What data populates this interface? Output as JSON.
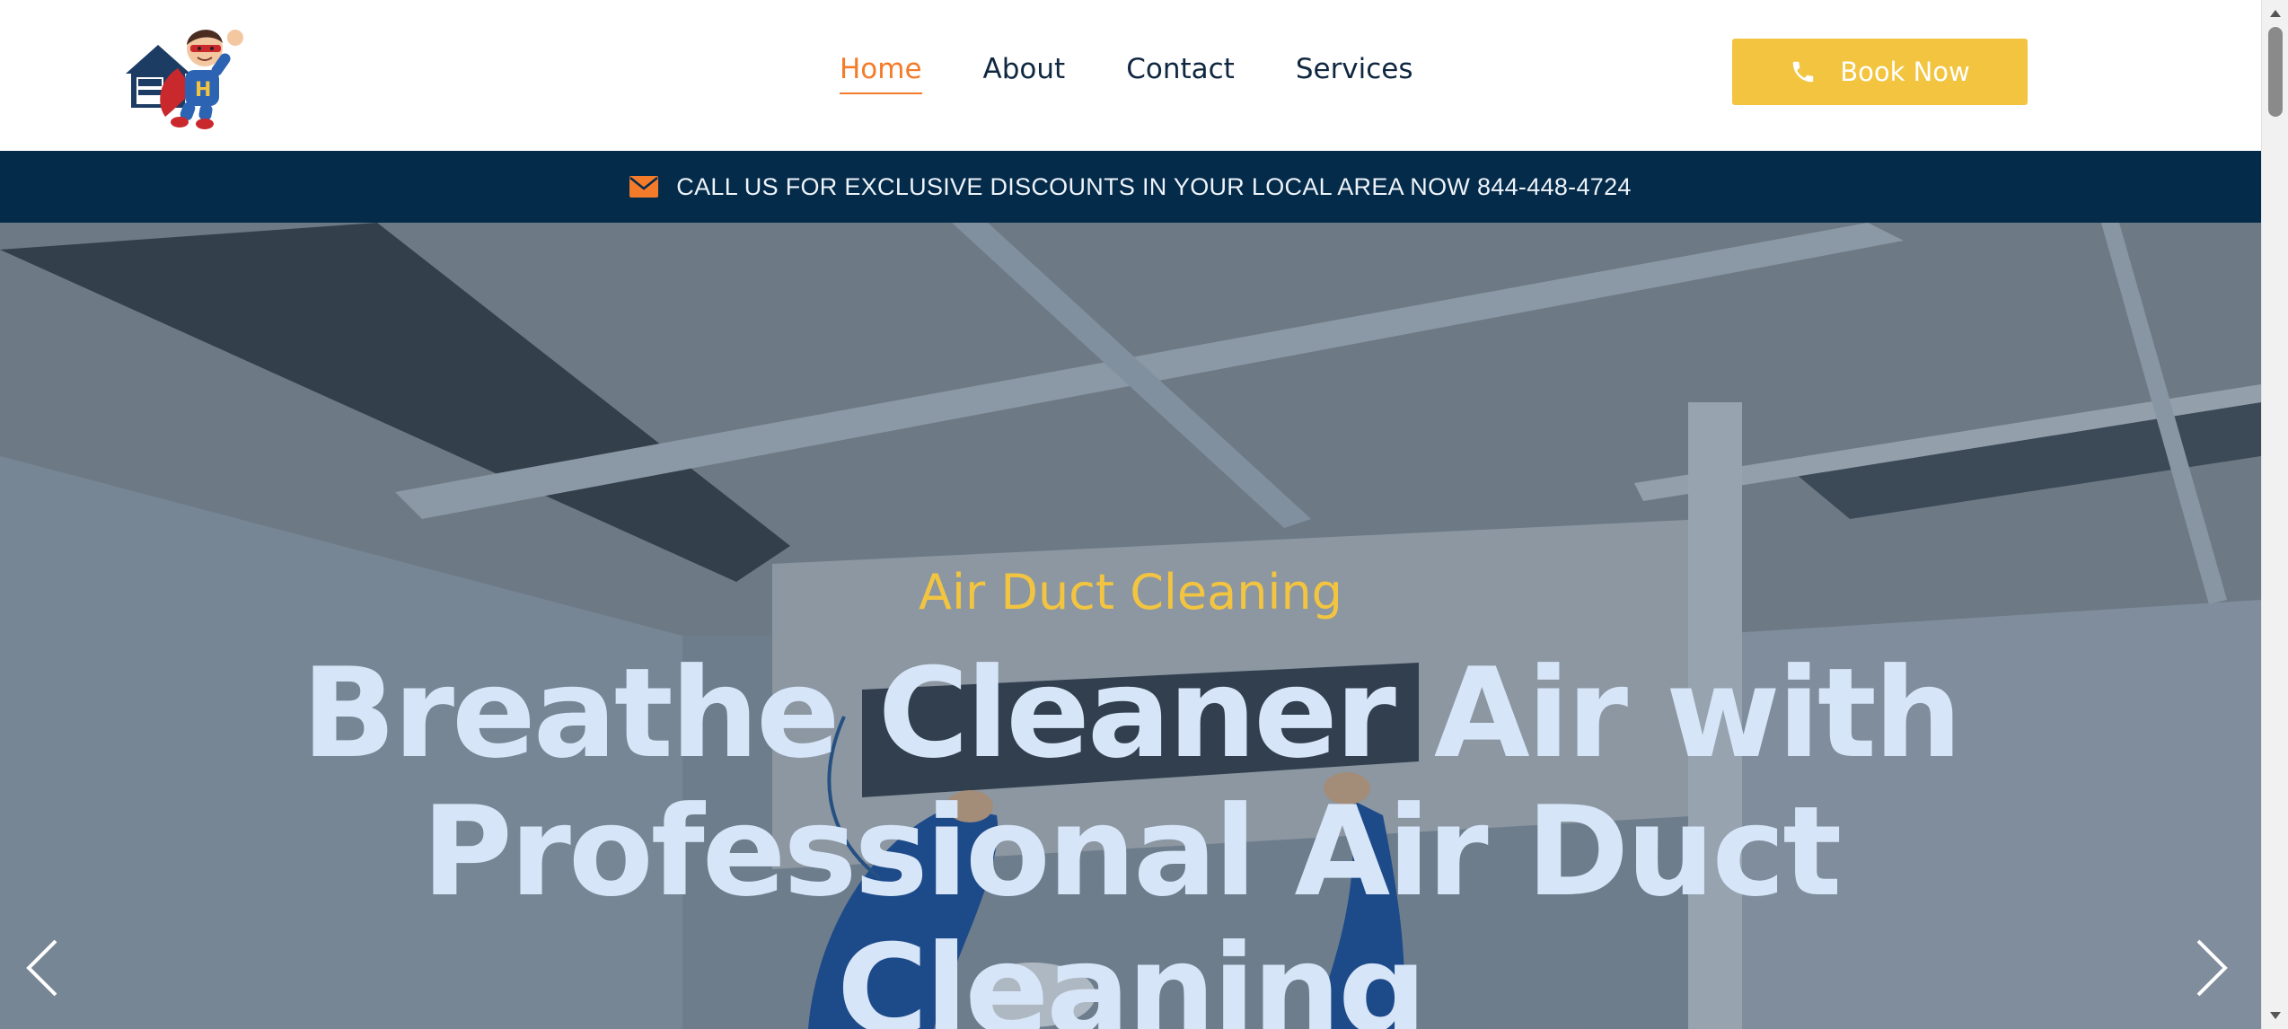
{
  "header": {
    "logo": {
      "icon": "superhero-house-logo",
      "letter": "H"
    },
    "nav": [
      {
        "label": "Home",
        "active": true
      },
      {
        "label": "About",
        "active": false
      },
      {
        "label": "Contact",
        "active": false
      },
      {
        "label": "Services",
        "active": false
      }
    ],
    "book_button": {
      "label": "Book Now",
      "icon": "phone-icon"
    }
  },
  "promo": {
    "icon": "envelope-icon",
    "text": "CALL US FOR EXCLUSIVE DISCOUNTS IN YOUR LOCAL AREA NOW 844-448-4724"
  },
  "hero": {
    "subtitle": "Air Duct Cleaning",
    "title": "Breathe Cleaner Air with Professional Air Duct Cleaning",
    "prev_icon": "chevron-left-icon",
    "next_icon": "chevron-right-icon"
  },
  "colors": {
    "accent_orange": "#f47b2a",
    "accent_yellow": "#f2c440",
    "navy": "#042b4a",
    "hero_title": "#d7e5f8"
  }
}
